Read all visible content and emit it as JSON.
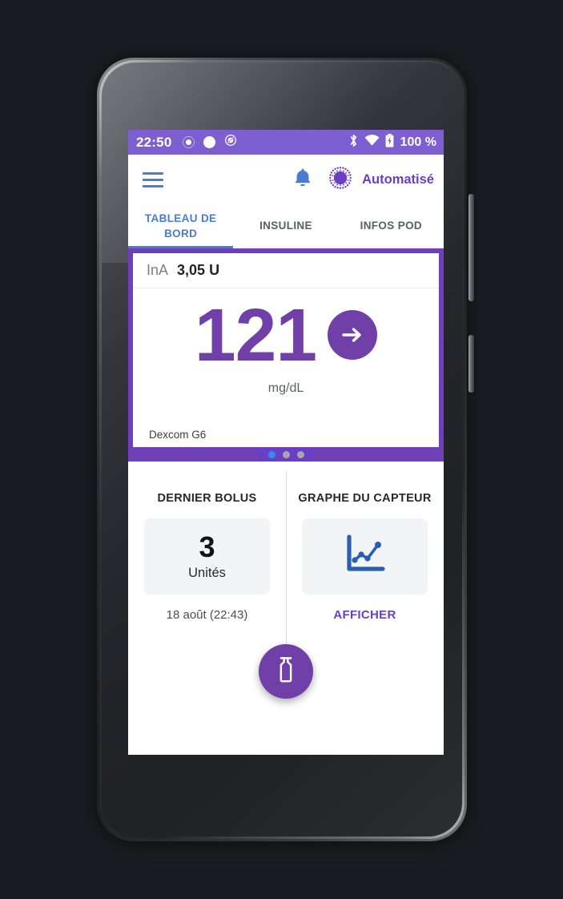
{
  "device": {
    "frame": "smartphone",
    "accent_purple": "#6b3fc4",
    "accent_blue": "#4a7cd0",
    "status_bar_purple": "#7e5fd1"
  },
  "status_bar": {
    "time": "22:50",
    "left_icons": [
      "recording-ring-icon",
      "recording-dot-icon",
      "do-not-disturb-icon"
    ],
    "right_icons": [
      "bluetooth-icon",
      "wifi-icon",
      "battery-icon"
    ],
    "battery_text": "100 %"
  },
  "app_bar": {
    "menu_icon": "hamburger-menu-icon",
    "bell_icon": "notification-bell-icon",
    "mode_icon": "automated-mode-icon",
    "mode_label": "Automatisé"
  },
  "tabs": [
    {
      "label": "TABLEAU DE BORD",
      "active": true
    },
    {
      "label": "INSULINE",
      "active": false
    },
    {
      "label": "INFOS POD",
      "active": false
    }
  ],
  "glucose_card": {
    "iob_label": "InA",
    "iob_value": "3,05 U",
    "reading": "121",
    "trend_icon": "arrow-right-icon",
    "unit": "mg/dL",
    "source": "Dexcom G6"
  },
  "pager": {
    "dots": 3,
    "active_index": 0
  },
  "bottom": {
    "last_bolus": {
      "title": "DERNIER BOLUS",
      "amount": "3",
      "unit_label": "Unités",
      "timestamp": "18 août (22:43)"
    },
    "sensor_graph": {
      "title": "GRAPHE DU CAPTEUR",
      "icon": "line-chart-icon",
      "action_label": "AFFICHER"
    },
    "fab": {
      "icon": "insulin-vial-icon"
    }
  }
}
